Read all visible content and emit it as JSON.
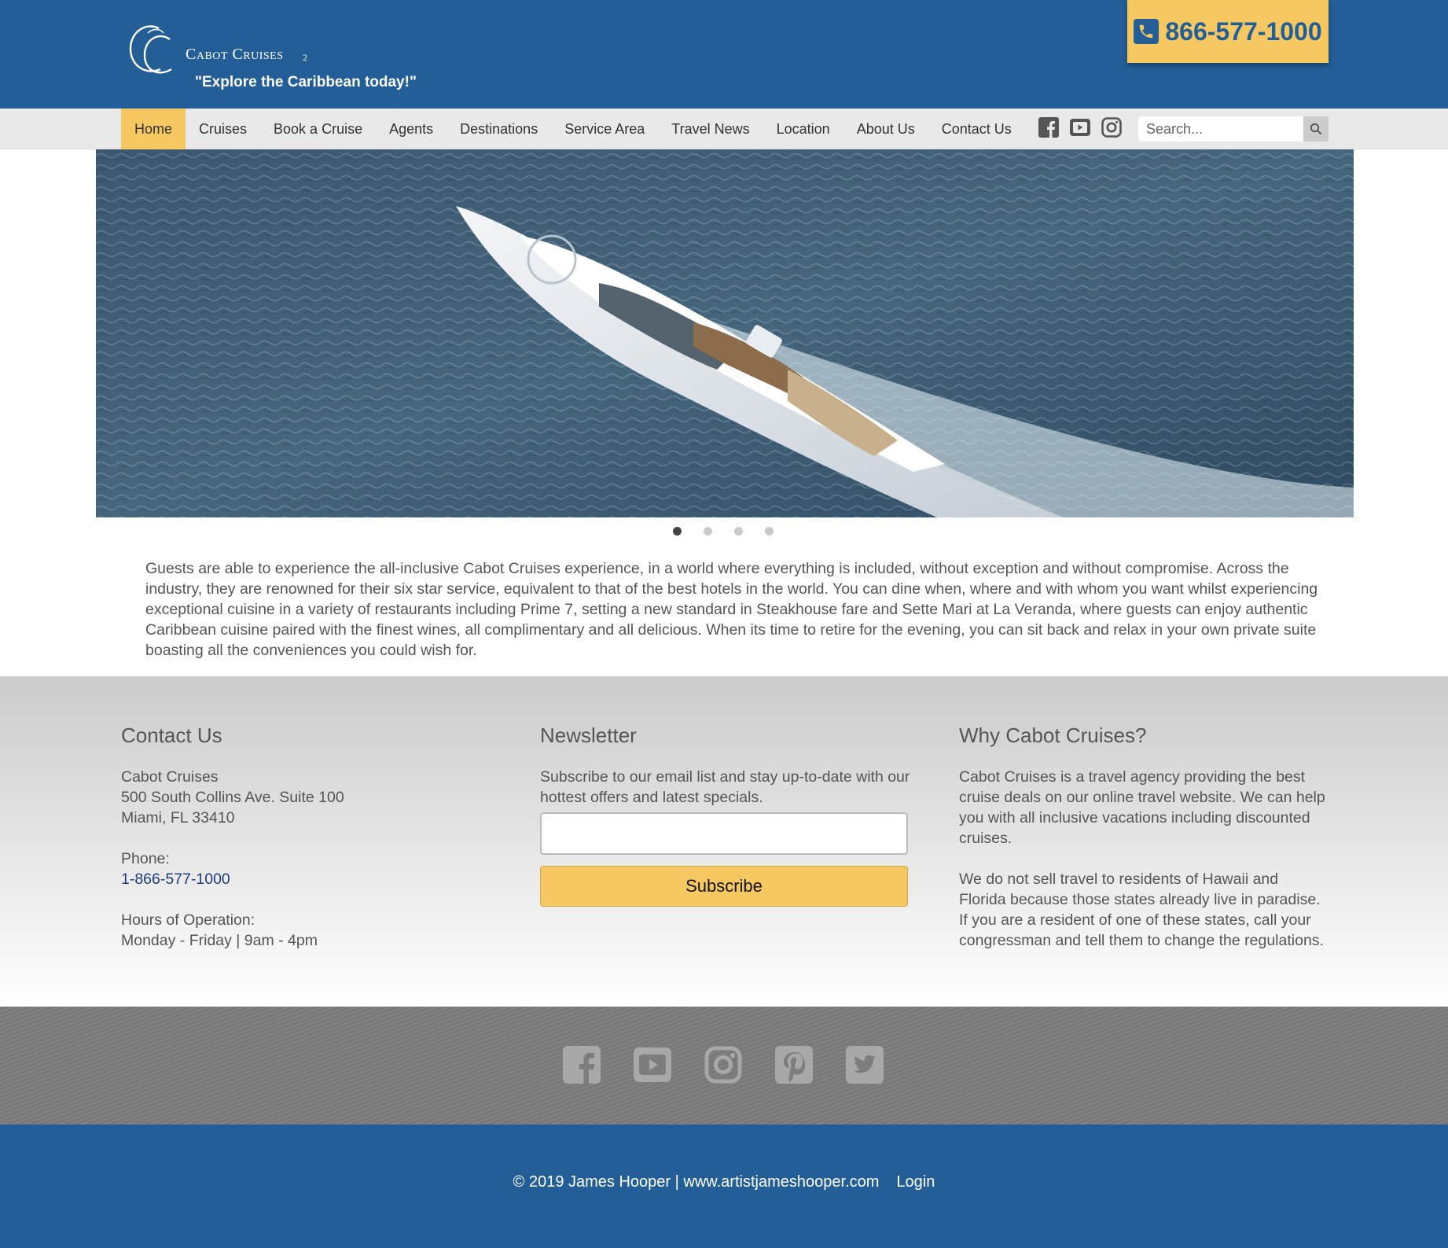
{
  "header": {
    "brand": "Cabot Cruises",
    "brand_sup": "2",
    "tagline": "\"Explore the Caribbean today!\"",
    "phone": "866-577-1000"
  },
  "nav": {
    "items": [
      {
        "label": "Home",
        "active": true
      },
      {
        "label": "Cruises"
      },
      {
        "label": "Book a Cruise"
      },
      {
        "label": "Agents"
      },
      {
        "label": "Destinations"
      },
      {
        "label": "Service Area"
      },
      {
        "label": "Travel News"
      },
      {
        "label": "Location"
      },
      {
        "label": "About Us"
      },
      {
        "label": "Contact Us"
      }
    ],
    "social_icons": [
      "facebook-icon",
      "youtube-icon",
      "instagram-icon"
    ],
    "search_placeholder": "Search..."
  },
  "carousel": {
    "slide_count": 4,
    "active_index": 0
  },
  "intro": {
    "text": "Guests are able to experience the all-inclusive Cabot Cruises experience, in a world where everything is included, without exception and without compromise. Across the industry, they are renowned for their six star service, equivalent to that of the best hotels in the world. You can dine when, where and with whom you want whilst experiencing exceptional cuisine in a variety of restaurants including Prime 7, setting a new standard in Steakhouse fare and Sette Mari at La Veranda, where guests can enjoy authentic Caribbean cuisine paired with the finest wines, all complimentary and all delicious. When its time to retire for the evening, you can sit back and relax in your own private suite boasting all the conveniences you could wish for."
  },
  "footer": {
    "contact": {
      "heading": "Contact Us",
      "name": "Cabot Cruises",
      "address1": "500 South Collins Ave. Suite 100",
      "address2": "Miami, FL 33410",
      "phone_label": "Phone:",
      "phone": "1-866-577-1000",
      "hours_label": "Hours of Operation:",
      "hours": "Monday - Friday | 9am - 4pm"
    },
    "newsletter": {
      "heading": "Newsletter",
      "text": "Subscribe to our email list and stay up-to-date with our hottest offers and latest specials.",
      "email_value": "",
      "button": "Subscribe"
    },
    "why": {
      "heading": "Why Cabot Cruises?",
      "p1": "Cabot Cruises is a travel agency providing the best cruise deals on our online travel website. We can help you with all inclusive vacations including discounted cruises.",
      "p2": "We do not sell travel to residents of Hawaii and Florida because those states already live in paradise. If you are a resident of one of these states, call your congressman and tell them to change the regulations."
    },
    "social_icons": [
      "facebook-icon",
      "youtube-icon",
      "instagram-icon",
      "pinterest-icon",
      "twitter-icon"
    ],
    "copyright": "© 2019 James Hooper | www.artistjameshooper.com",
    "login": "Login"
  },
  "colors": {
    "brand_blue": "#235e97",
    "accent_yellow": "#f5c862",
    "nav_bg": "#e9e9e9",
    "social_band": "#7d7d7d"
  }
}
